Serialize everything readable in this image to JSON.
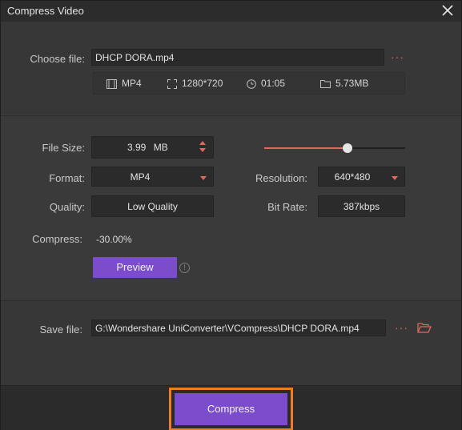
{
  "window": {
    "title": "Compress Video"
  },
  "choose_file": {
    "label": "Choose file:",
    "value": "DHCP DORA.mp4"
  },
  "file_info": {
    "format": "MP4",
    "resolution": "1280*720",
    "duration": "01:05",
    "size": "5.73MB"
  },
  "settings": {
    "file_size_label": "File Size:",
    "file_size_value": "3.99",
    "file_size_unit": "MB",
    "size_slider_fraction": 0.59,
    "format_label": "Format:",
    "format_value": "MP4",
    "resolution_label": "Resolution:",
    "resolution_value": "640*480",
    "quality_label": "Quality:",
    "quality_value": "Low Quality",
    "bitrate_label": "Bit Rate:",
    "bitrate_value": "387kbps",
    "compress_label": "Compress:",
    "compress_value": "-30.00%",
    "preview_label": "Preview"
  },
  "save_file": {
    "label": "Save file:",
    "value": "G:\\Wondershare UniConverter\\VCompress\\DHCP DORA.mp4"
  },
  "footer": {
    "compress_label": "Compress"
  },
  "colors": {
    "accent": "#e0685e",
    "button": "#7b4ccc",
    "highlight": "#f07e1e"
  }
}
